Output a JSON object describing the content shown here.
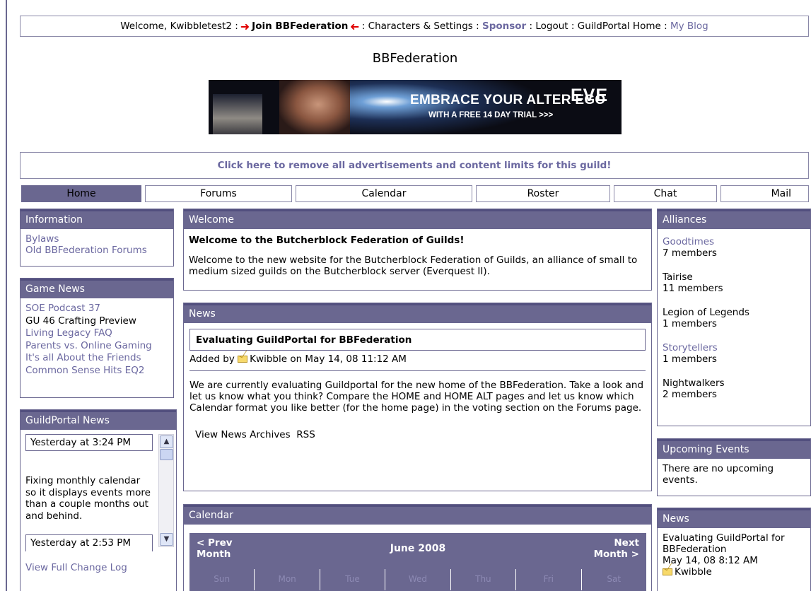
{
  "topbar": {
    "welcome": "Welcome, Kwibbletest2 :",
    "join": "Join BBFederation",
    "sep1": ":",
    "characters": "Characters & Settings",
    "sep2": ":",
    "sponsor": "Sponsor",
    "sep3": ":",
    "logout": "Logout",
    "sep4": ":",
    "home": "GuildPortal Home",
    "sep5": ":",
    "blog": "My Blog"
  },
  "site": {
    "title": "BBFederation"
  },
  "banner": {
    "line1": "EMBRACE YOUR ALTER EGO",
    "line2": "WITH A FREE 14 DAY TRIAL >>>",
    "logo": "EVE"
  },
  "ad": {
    "remove_text": "Click here to remove all advertisements and content limits for this guild!"
  },
  "nav": {
    "tabs": [
      "Home",
      "Forums",
      "Calendar",
      "Roster",
      "Chat",
      "Mail"
    ],
    "active": "Home"
  },
  "information": {
    "title": "Information",
    "links": [
      "Bylaws",
      "Old BBFederation Forums"
    ]
  },
  "game_news": {
    "title": "Game News",
    "items": [
      "SOE Podcast 37",
      "GU 46 Crafting Preview",
      "Living Legacy FAQ",
      "Parents vs. Online Gaming",
      "It's all About the Friends",
      "Common Sense Hits EQ2"
    ]
  },
  "gp_news": {
    "title": "GuildPortal News",
    "entry1_time": "Yesterday at 3:24 PM",
    "entry1_text": "Fixing monthly calendar so it displays events more than a couple months out and behind.",
    "entry2_time": "Yesterday at 2:53 PM",
    "changelog": "View Full Change Log"
  },
  "welcome": {
    "title": "Welcome",
    "heading": "Welcome to the Butcherblock Federation of Guilds!",
    "body": "Welcome to the new website for the Butcherblock Federation of Guilds, an alliance of small to medium sized guilds on the Butcherblock server (Everquest II)."
  },
  "news": {
    "title": "News",
    "item_title": "Evaluating GuildPortal for BBFederation",
    "added_by": "Added by",
    "author": "Kwibble",
    "date": "on May 14, 08 11:12 AM",
    "body": "We are currently evaluating Guildportal for the new home of the BBFederation. Take a look and let us know what you think?  Compare the HOME and HOME ALT pages and let us know which Calendar format you like better (for the home page) in the voting section on the Forums page.",
    "archives": "View News Archives",
    "rss": "RSS"
  },
  "calendar": {
    "title": "Calendar",
    "prev": "< Prev Month",
    "next": "Next Month >",
    "month": "June 2008",
    "days": [
      "Sun",
      "Mon",
      "Tue",
      "Wed",
      "Thu",
      "Fri",
      "Sat"
    ]
  },
  "alliances": {
    "title": "Alliances",
    "items": [
      {
        "name": "Goodtimes",
        "members": "7 members",
        "link": true
      },
      {
        "name": "Tairise",
        "members": "11 members",
        "link": false
      },
      {
        "name": "Legion of Legends",
        "members": "1 members",
        "link": false
      },
      {
        "name": "Storytellers",
        "members": "1 members",
        "link": true
      },
      {
        "name": "Nightwalkers",
        "members": "2 members",
        "link": false
      }
    ]
  },
  "upcoming": {
    "title": "Upcoming Events",
    "text": "There are no upcoming events."
  },
  "side_news": {
    "title": "News",
    "item": "Evaluating GuildPortal for BBFederation",
    "date": "May 14, 08 8:12 AM",
    "author": "Kwibble"
  },
  "colors": {
    "accent": "#6a6790",
    "link": "#6b68a0",
    "arrow": "#e00000"
  }
}
